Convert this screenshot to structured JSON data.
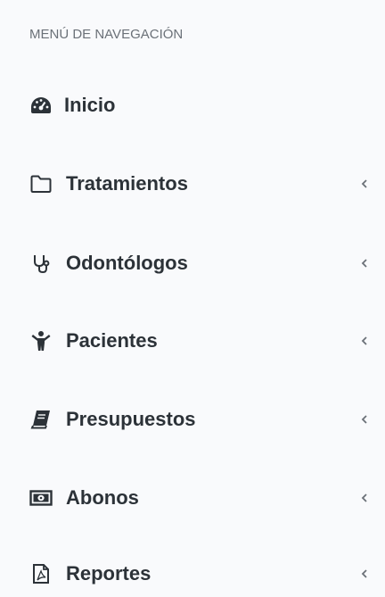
{
  "sidebar": {
    "header": "MENÚ DE NAVEGACIÓN",
    "items": [
      {
        "label": "Inicio",
        "icon": "dashboard-icon",
        "has_submenu": false
      },
      {
        "label": "Tratamientos",
        "icon": "folder-icon",
        "has_submenu": true
      },
      {
        "label": "Odontólogos",
        "icon": "stethoscope-icon",
        "has_submenu": true
      },
      {
        "label": "Pacientes",
        "icon": "child-icon",
        "has_submenu": true
      },
      {
        "label": "Presupuestos",
        "icon": "book-icon",
        "has_submenu": true
      },
      {
        "label": "Abonos",
        "icon": "money-icon",
        "has_submenu": true
      },
      {
        "label": "Reportes",
        "icon": "file-pdf-icon",
        "has_submenu": true
      }
    ]
  },
  "colors": {
    "background": "#f9fafc",
    "text": "#2c3238",
    "header_text": "#6b7178"
  }
}
